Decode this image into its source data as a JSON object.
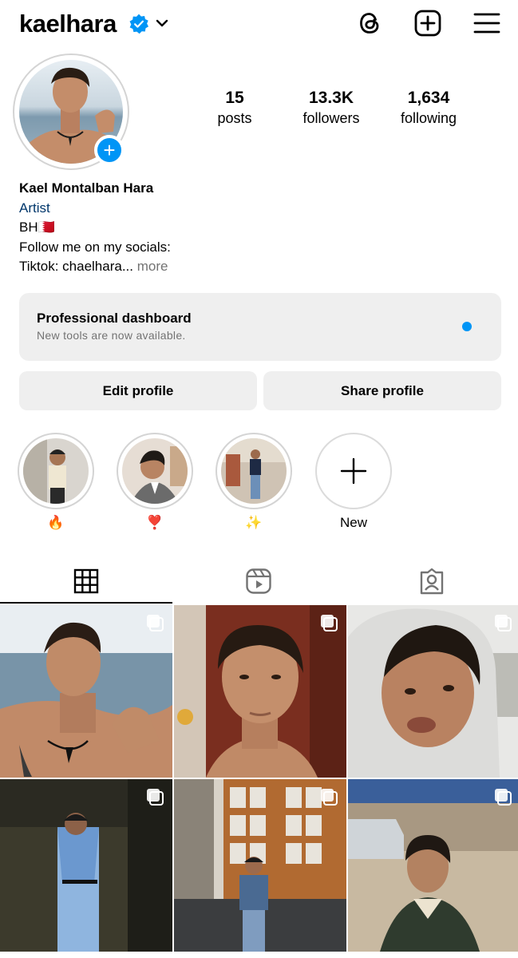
{
  "header": {
    "username": "kaelhara",
    "icons": [
      "verified-badge-icon",
      "chevron-down-icon",
      "threads-icon",
      "create-plus-icon",
      "menu-icon"
    ]
  },
  "profile": {
    "stats": [
      {
        "value": "15",
        "label": "posts"
      },
      {
        "value": "13.3K",
        "label": "followers"
      },
      {
        "value": "1,634",
        "label": "following"
      }
    ],
    "full_name": "Kael Montalban Hara",
    "category": "Artist",
    "bio_line1": "BH",
    "bio_flag": "🇧🇭",
    "bio_line2": "Follow me on my socials:",
    "bio_line3": "Tiktok: chaelhara...",
    "more_label": "more"
  },
  "dashboard": {
    "title": "Professional dashboard",
    "subtitle": "New tools are now available."
  },
  "buttons": {
    "edit": "Edit profile",
    "share": "Share profile"
  },
  "highlights": [
    {
      "label": "🔥"
    },
    {
      "label": "❣️"
    },
    {
      "label": "✨"
    },
    {
      "label": "New"
    }
  ],
  "tabs": [
    "grid-icon",
    "reels-icon",
    "tagged-icon"
  ],
  "colors": {
    "accent": "#0095f6",
    "category_link": "#00376b",
    "secondary_text": "#737373",
    "button_bg": "#efefef"
  }
}
